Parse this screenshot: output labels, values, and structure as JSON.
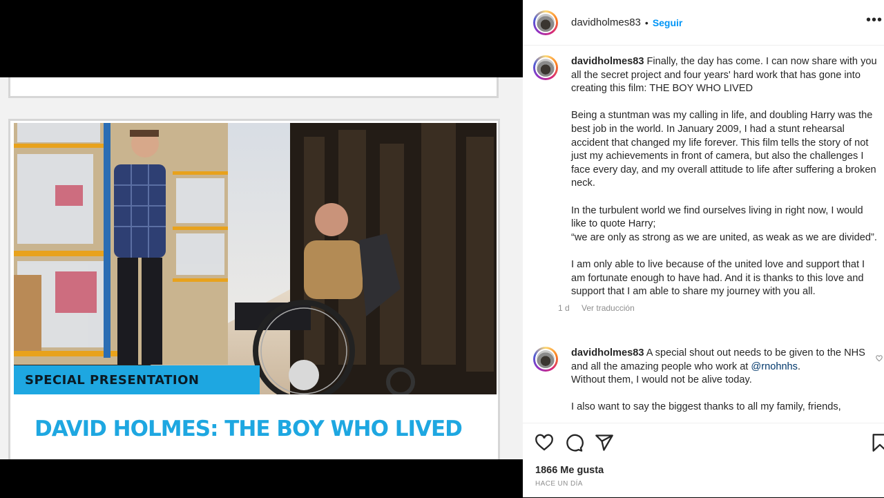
{
  "media": {
    "banner_label": "SPECIAL PRESENTATION",
    "title": "DAVID HOLMES: THE BOY WHO LIVED"
  },
  "header": {
    "username": "davidholmes83",
    "separator": "•",
    "follow_label": "Seguir",
    "more_icon": "more-options-icon"
  },
  "comments": [
    {
      "username": "davidholmes83",
      "text": " Finally, the day has come. I can now share with you all the secret project and four years' hard work that has gone into creating this film: THE BOY WHO LIVED\n\nBeing a stuntman was my calling in life, and doubling Harry was the best job in the world. In January 2009, I had a stunt rehearsal accident that changed my life forever. This film tells the story of not just my achievements in front of camera, but also the challenges I face every day, and my overall attitude to life after suffering a broken neck.\n\nIn the turbulent world we find ourselves living in right now, I would like to quote Harry;\n“we are only as strong as we are united, as weak as we are divided”.\n\nI am only able to live because of the united love and support that I am fortunate enough to have had. And it is thanks to this love and support that I am able to share my journey with you all.",
      "time": "1 d",
      "translate": "Ver traducción"
    },
    {
      "username": "davidholmes83",
      "text_before": " A special shout out needs to be given to the NHS and all the amazing people who work at ",
      "mention": "@rnohnhs",
      "text_after": ".\nWithout them, I would not be alive today.\n\nI also want to say the biggest thanks to all my family, friends,"
    }
  ],
  "actions": {
    "like_icon": "heart-icon",
    "comment_icon": "comment-icon",
    "share_icon": "share-icon",
    "save_icon": "bookmark-icon",
    "likes": "1866 Me gusta",
    "ago": "HACE UN DÍA"
  },
  "colors": {
    "accent": "#0095f6",
    "banner": "#1ea7e1"
  }
}
